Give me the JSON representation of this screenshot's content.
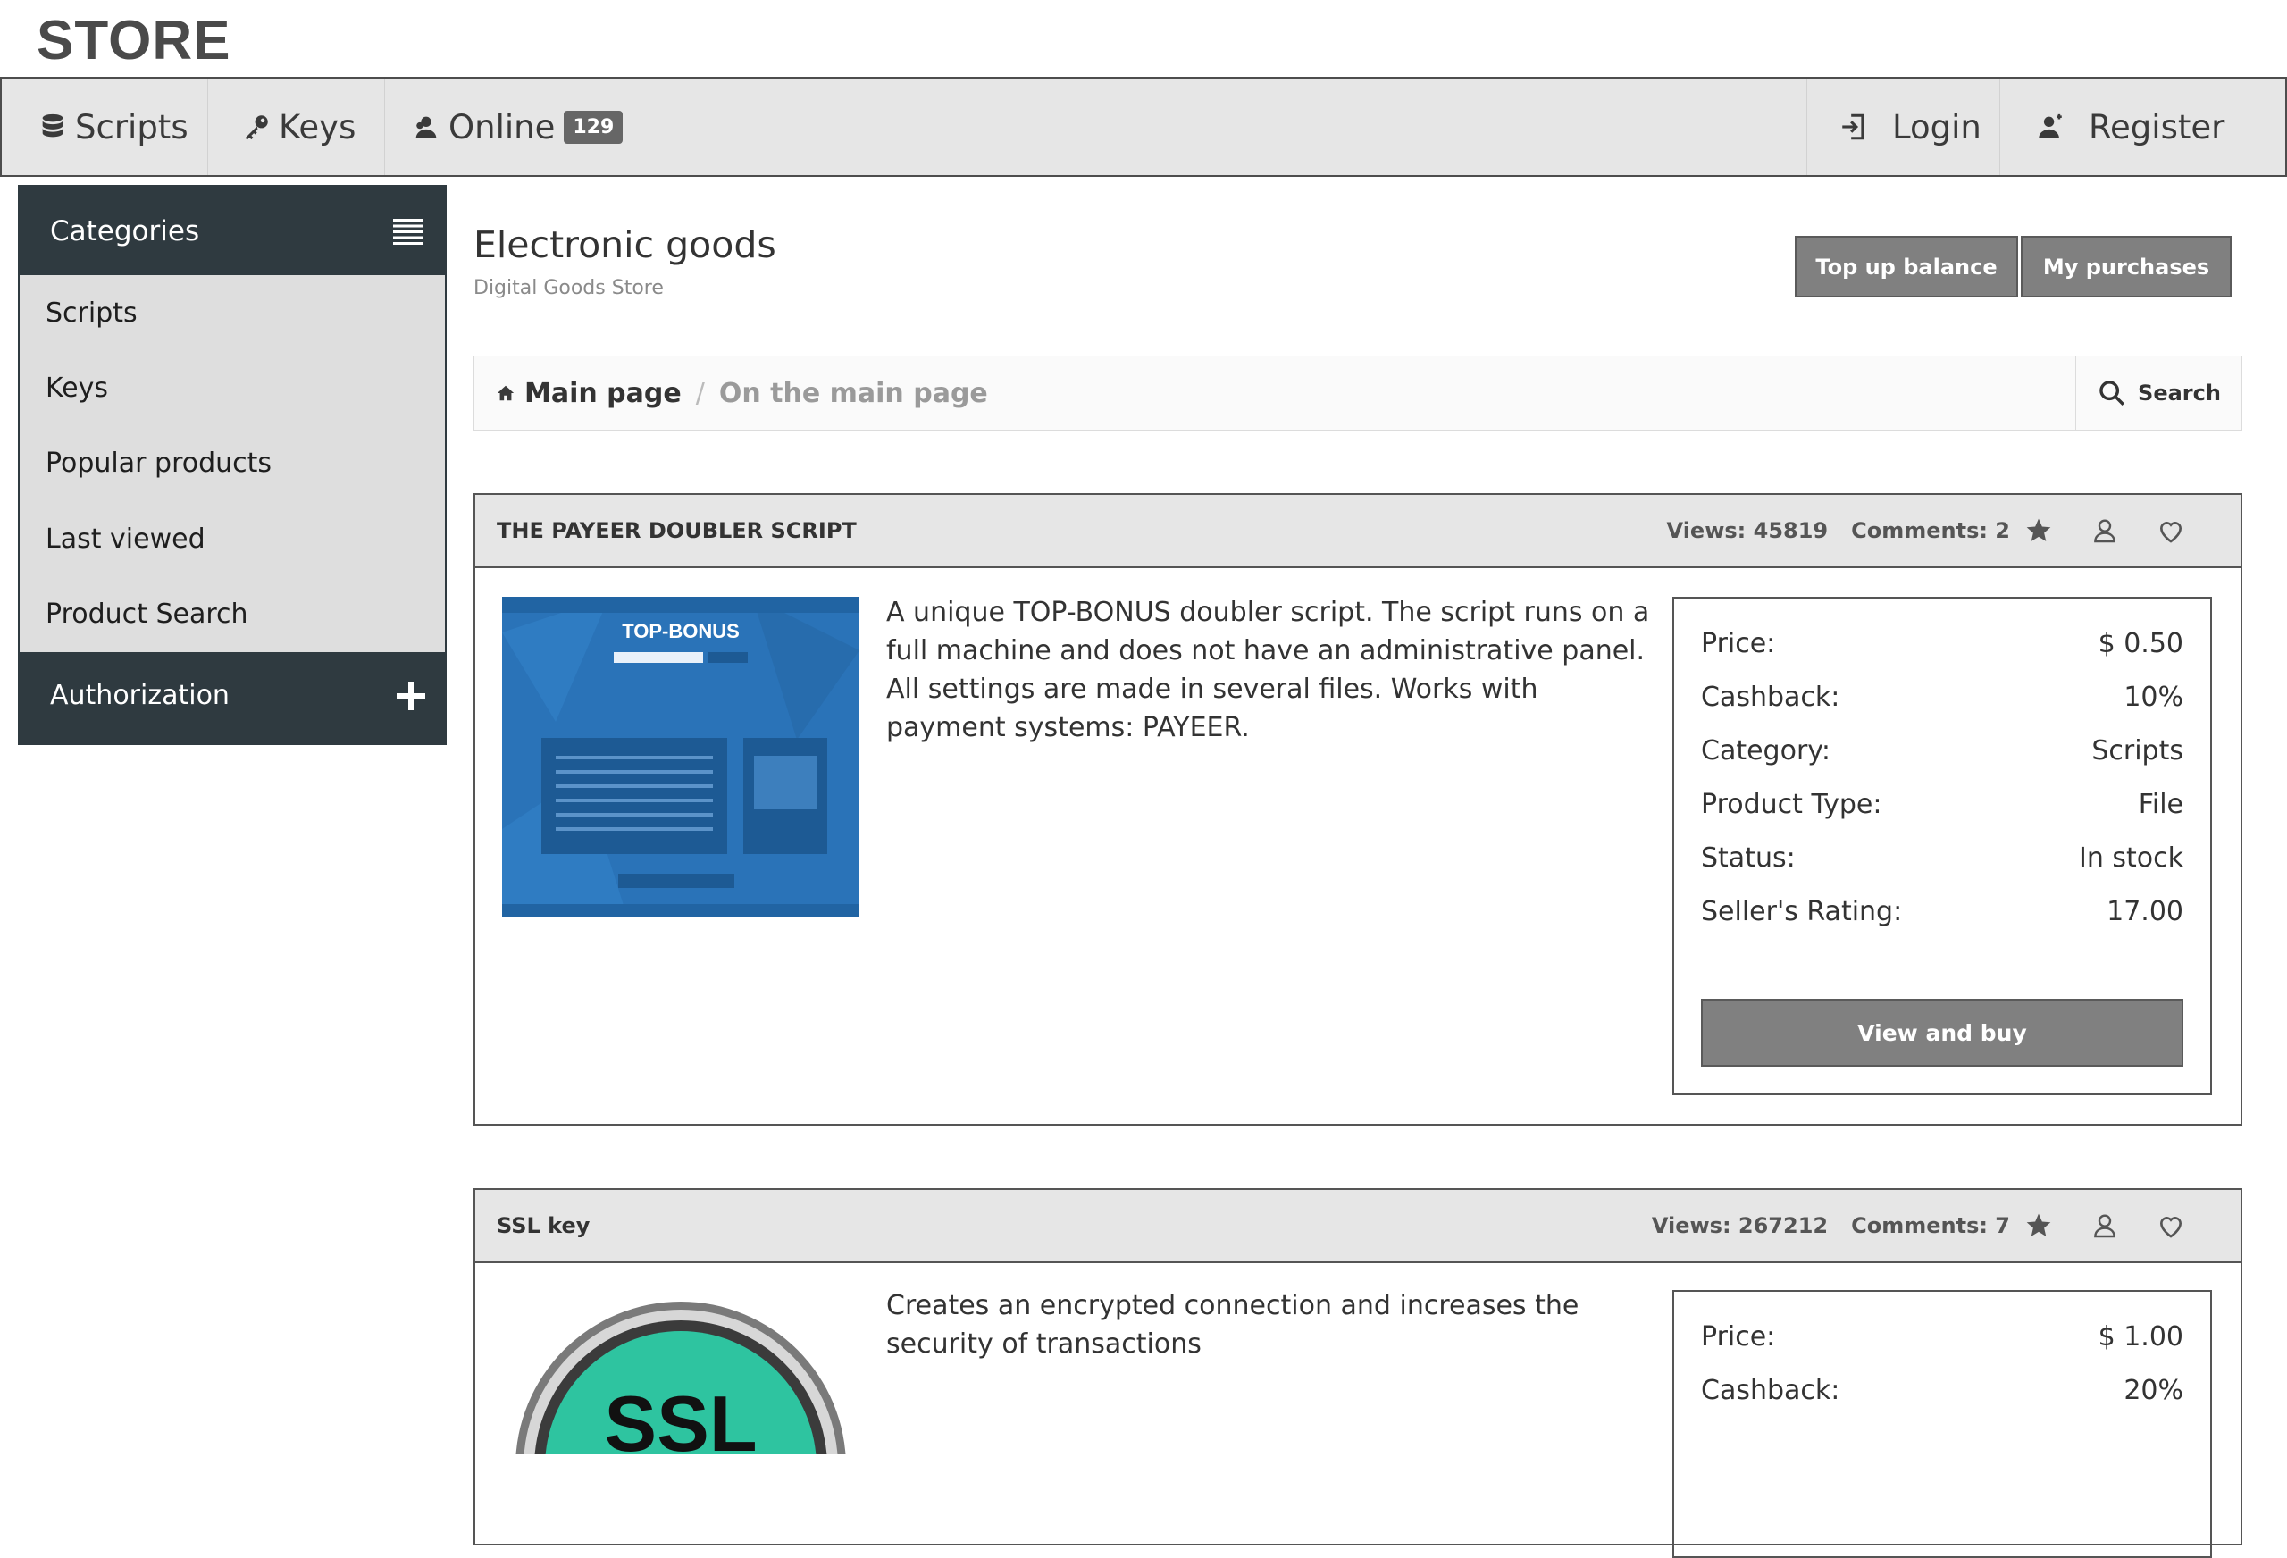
{
  "brand": {
    "logo": "STORE"
  },
  "nav": {
    "scripts": "Scripts",
    "keys": "Keys",
    "online": "Online",
    "online_count": "129",
    "login": "Login",
    "register": "Register"
  },
  "sidebar": {
    "title": "Categories",
    "items": [
      {
        "label": "Scripts"
      },
      {
        "label": "Keys"
      },
      {
        "label": "Popular products"
      },
      {
        "label": "Last viewed"
      },
      {
        "label": "Product Search"
      }
    ],
    "auth": "Authorization"
  },
  "page": {
    "title": "Electronic goods",
    "subtitle": "Digital Goods Store",
    "top_up": "Top up balance",
    "purchases": "My purchases"
  },
  "breadcrumb": {
    "main": "Main page",
    "separator": "/",
    "current": "On the main page",
    "search": "Search"
  },
  "products": [
    {
      "title": "THE PAYEER DOUBLER SCRIPT",
      "views": "Views: 45819",
      "comments": "Comments: 2",
      "description": "A unique TOP-BONUS doubler script. The script runs on a full machine and does not have an administrative panel. All settings are made in several files. Works with payment systems: PAYEER.",
      "image_text": "TOP-BONUS",
      "fields": [
        {
          "label": "Price:",
          "value": "$ 0.50"
        },
        {
          "label": "Cashback:",
          "value": "10%"
        },
        {
          "label": "Category:",
          "value": "Scripts"
        },
        {
          "label": "Product Type:",
          "value": "File"
        },
        {
          "label": "Status:",
          "value": "In stock"
        },
        {
          "label": "Seller's Rating:",
          "value": "17.00"
        }
      ],
      "buy": "View and buy"
    },
    {
      "title": "SSL key",
      "views": "Views: 267212",
      "comments": "Comments: 7",
      "description": "Creates an encrypted connection and increases the security of transactions",
      "image_text": "SSL",
      "fields": [
        {
          "label": "Price:",
          "value": "$ 1.00"
        },
        {
          "label": "Cashback:",
          "value": "20%"
        }
      ]
    }
  ],
  "colors": {
    "nav_bg": "#e6e6e6",
    "sidebar_dark": "#2f3a40",
    "sidebar_list": "#dedede",
    "button_gray": "#808080",
    "script_blue": "#2a73b8",
    "ssl_teal": "#2ec4a0"
  }
}
